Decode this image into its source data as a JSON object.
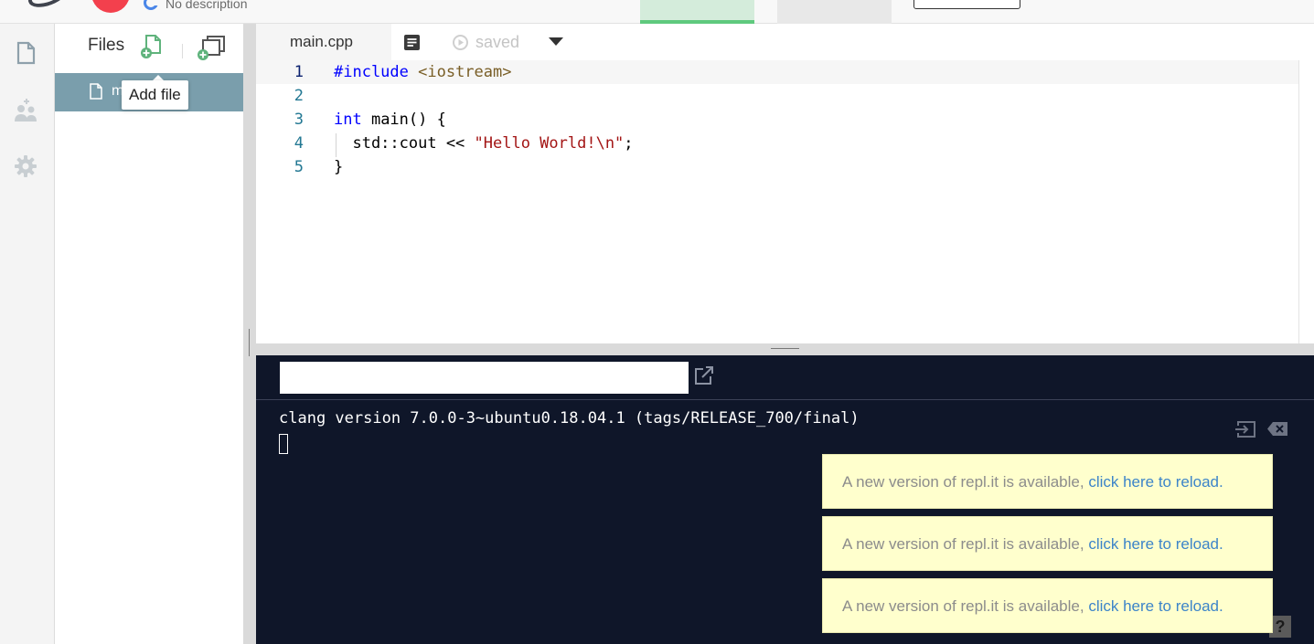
{
  "topbar": {
    "description": "No description",
    "colors": {
      "run": "#f3404d",
      "tab_active": "#5fc97e"
    }
  },
  "files_panel": {
    "title": "Files",
    "tooltip": "Add file",
    "items": [
      {
        "label": "main.cpp",
        "visible_label": "m"
      }
    ]
  },
  "editor": {
    "tab_label": "main.cpp",
    "status": "saved",
    "lines": [
      {
        "num": "1",
        "tokens": [
          {
            "t": "#include ",
            "c": "kw"
          },
          {
            "t": "<iostream>",
            "c": "inc"
          }
        ]
      },
      {
        "num": "2",
        "tokens": []
      },
      {
        "num": "3",
        "tokens": [
          {
            "t": "int",
            "c": "kw"
          },
          {
            "t": " main() {",
            "c": ""
          }
        ]
      },
      {
        "num": "4",
        "tokens": [
          {
            "t": "  std::cout << ",
            "c": ""
          },
          {
            "t": "\"Hello World!\\n\"",
            "c": "str"
          },
          {
            "t": ";",
            "c": ""
          }
        ]
      },
      {
        "num": "5",
        "tokens": [
          {
            "t": "}",
            "c": ""
          }
        ]
      }
    ]
  },
  "console": {
    "url_value": "",
    "output_line": "clang version 7.0.0-3~ubuntu0.18.04.1 (tags/RELEASE_700/final)",
    "help_label": "?"
  },
  "notifications": [
    {
      "text": "A new version of repl.it is available, ",
      "link": "click here to reload."
    },
    {
      "text": "A new version of repl.it is available, ",
      "link": "click here to reload."
    },
    {
      "text": "A new version of repl.it is available, ",
      "link": "click here to reload."
    }
  ]
}
